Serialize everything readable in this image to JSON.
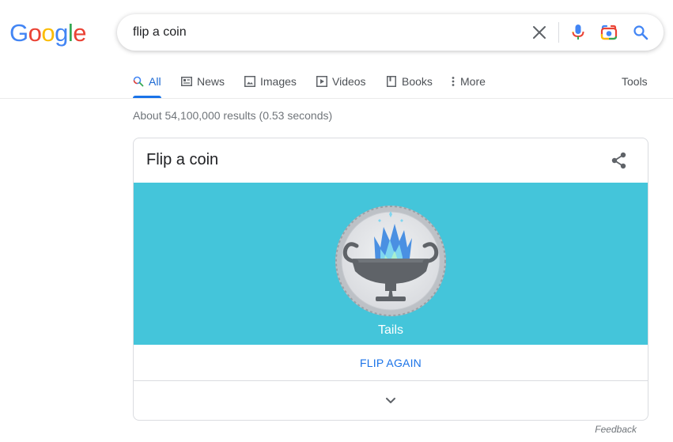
{
  "logo": {
    "letters": [
      "G",
      "o",
      "o",
      "g",
      "l",
      "e"
    ],
    "colors": [
      "#4285F4",
      "#EA4335",
      "#FBBC05",
      "#4285F4",
      "#34A853",
      "#EA4335"
    ]
  },
  "search": {
    "value": "flip a coin",
    "icons": [
      "close-icon",
      "microphone-icon",
      "camera-lens-icon",
      "search-icon"
    ]
  },
  "tabs": [
    {
      "label": "All",
      "icon": "search-icon",
      "active": true
    },
    {
      "label": "News",
      "icon": "newspaper-icon"
    },
    {
      "label": "Images",
      "icon": "image-icon"
    },
    {
      "label": "Videos",
      "icon": "play-icon"
    },
    {
      "label": "Books",
      "icon": "book-icon"
    },
    {
      "label": "More",
      "icon": "more-vert-icon"
    }
  ],
  "tools_label": "Tools",
  "stats": "About 54,100,000 results (0.53 seconds)",
  "card": {
    "title": "Flip a coin",
    "share_icon": "share-icon",
    "result": "Tails",
    "flip_again_label": "FLIP AGAIN",
    "expand_icon": "chevron-down-icon",
    "coin_background": "#44c5da"
  },
  "feedback_label": "Feedback",
  "colors": {
    "accent": "#1a73e8",
    "text": "#202124",
    "muted": "#70757a"
  }
}
